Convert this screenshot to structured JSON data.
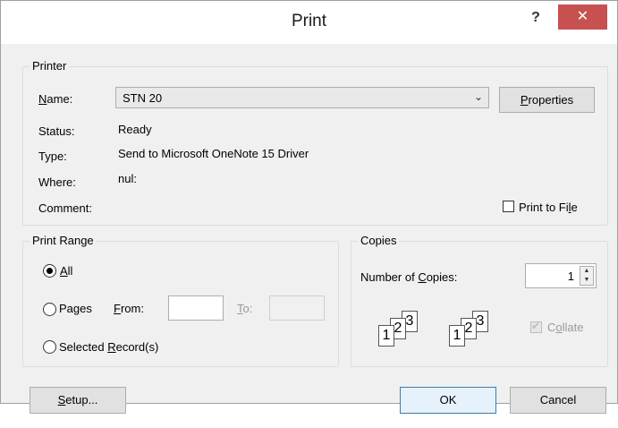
{
  "window": {
    "title": "Print",
    "help_label": "?",
    "close_label": "✕"
  },
  "printer": {
    "group_label": "Printer",
    "name_label": "Name:",
    "name_value": "STN 20",
    "properties_label": "Properties",
    "status_label": "Status:",
    "status_value": "Ready",
    "type_label": "Type:",
    "type_value": "Send to Microsoft OneNote 15 Driver",
    "where_label": "Where:",
    "where_value": "nul:",
    "comment_label": "Comment:",
    "print_to_file_label": "Print to File"
  },
  "print_range": {
    "group_label": "Print Range",
    "all_label": "All",
    "pages_label": "Pages",
    "from_label": "From:",
    "to_label": "To:",
    "selected_label": "Selected Record(s)",
    "selected_option": "All"
  },
  "copies": {
    "group_label": "Copies",
    "number_label": "Number of Copies:",
    "number_value": "1",
    "collate_label": "Collate",
    "collate_checked": true,
    "collate_pages": [
      "1",
      "2",
      "3"
    ]
  },
  "buttons": {
    "setup": "Setup...",
    "ok": "OK",
    "cancel": "Cancel"
  }
}
